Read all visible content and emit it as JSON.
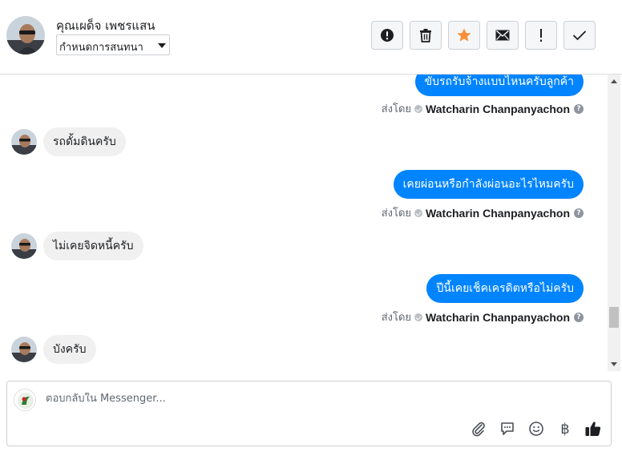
{
  "header": {
    "contact_name": "คุณเผด็จ เพชรแสน",
    "status_select": "กำหนดการสนทนา",
    "tools": [
      {
        "name": "report-spam-button",
        "icon": "alert-circle-icon"
      },
      {
        "name": "delete-button",
        "icon": "trash-icon"
      },
      {
        "name": "star-button",
        "icon": "star-icon"
      },
      {
        "name": "mark-unread-button",
        "icon": "envelope-icon"
      },
      {
        "name": "mark-important-button",
        "icon": "exclamation-icon"
      },
      {
        "name": "mark-done-button",
        "icon": "check-icon"
      }
    ]
  },
  "sent_by_prefix": "ส่งโดย",
  "agent_name": "Watcharin Chanpanyachon",
  "messages": [
    {
      "direction": "out",
      "text": "ขับรถรับจ้างแบบไหนครับลูกค้า"
    },
    {
      "direction": "in",
      "text": "รถดั้มดินครับ"
    },
    {
      "direction": "out",
      "text": "เคยผ่อนหรือกำลังผ่อนอะไรไหมครับ"
    },
    {
      "direction": "in",
      "text": "ไม่เคยจิดหนี้ครับ"
    },
    {
      "direction": "out",
      "text": "ปีนี้เคยเช็คเครดิตหรือไม่ครับ"
    },
    {
      "direction": "in",
      "text": "บังครับ"
    }
  ],
  "composer": {
    "placeholder": "ตอบกลับใน Messenger...",
    "icons": [
      "paperclip-icon",
      "saved-reply-icon",
      "emoji-icon",
      "baht-payment-icon",
      "thumbs-up-icon"
    ],
    "baht_symbol": "฿"
  },
  "colors": {
    "outgoing_bubble": "#0084ff",
    "incoming_bubble": "#f0f0f0",
    "star": "#f7923a"
  }
}
